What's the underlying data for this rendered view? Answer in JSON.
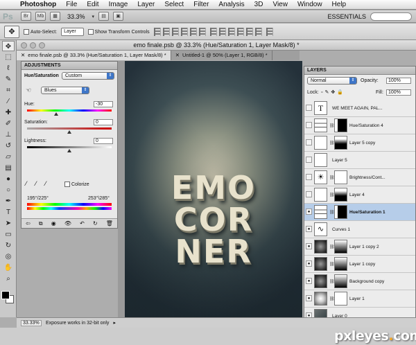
{
  "menubar": {
    "apple_icon": "apple-icon",
    "items": [
      "Photoshop",
      "File",
      "Edit",
      "Image",
      "Layer",
      "Select",
      "Filter",
      "Analysis",
      "3D",
      "View",
      "Window",
      "Help"
    ]
  },
  "appbar": {
    "logo": "Ps",
    "zoom": "33.3%",
    "workspace": "ESSENTIALS"
  },
  "options": {
    "auto_select_label": "Auto-Select:",
    "auto_select_value": "Layer",
    "transform_label": "Show Transform Controls"
  },
  "window": {
    "title": "emo finale.psb @ 33.3% (Hue/Saturation 1, Layer Mask/8) *"
  },
  "tabs": [
    {
      "label": "emo finale.psb @ 33.3% (Hue/Saturation 1, Layer Mask/8) *",
      "active": true
    },
    {
      "label": "Untitled-1 @ 50% (Layer 1, RGB/8) *",
      "active": false
    }
  ],
  "adjustments": {
    "panel_title": "ADJUSTMENTS",
    "type_label": "Hue/Saturation",
    "preset": "Custom",
    "channel": "Blues",
    "hue_label": "Hue:",
    "hue_value": "-30",
    "saturation_label": "Saturation:",
    "saturation_value": "0",
    "lightness_label": "Lightness:",
    "lightness_value": "0",
    "colorize_label": "Colorize",
    "range_left": "195°/225°",
    "range_right": "253°\\285°"
  },
  "canvas": {
    "lines": [
      "EMO",
      "COR",
      "NER"
    ]
  },
  "layers": {
    "panel_title": "LAYERS",
    "blend_mode": "Normal",
    "opacity_label": "Opacity:",
    "opacity_value": "100%",
    "lock_label": "Lock:",
    "fill_label": "Fill:",
    "fill_value": "100%",
    "items": [
      {
        "name": "WE MEET AGAIN, PAL...",
        "visible": false,
        "kind": "text"
      },
      {
        "name": "Hue/Saturation 4",
        "visible": false,
        "kind": "hue"
      },
      {
        "name": "Layer 5 copy",
        "visible": false,
        "kind": "mask"
      },
      {
        "name": "Layer 5",
        "visible": false,
        "kind": "blank"
      },
      {
        "name": "Brightness/Cont...",
        "visible": false,
        "kind": "bright"
      },
      {
        "name": "Layer 4",
        "visible": false,
        "kind": "mask"
      },
      {
        "name": "Hue/Saturation 1",
        "visible": true,
        "kind": "hue",
        "active": true
      },
      {
        "name": "Curves 1",
        "visible": true,
        "kind": "curves"
      },
      {
        "name": "Layer 1 copy 2",
        "visible": true,
        "kind": "dark"
      },
      {
        "name": "Layer 1 copy",
        "visible": true,
        "kind": "dark"
      },
      {
        "name": "Background copy",
        "visible": true,
        "kind": "dark"
      },
      {
        "name": "Layer 1",
        "visible": true,
        "kind": "mid"
      },
      {
        "name": "Layer 0",
        "visible": true,
        "kind": "photo"
      }
    ]
  },
  "status": {
    "zoom": "33.33%",
    "message": "Exposure works in 32-bit only"
  },
  "watermark": {
    "text": "pxleyes.com"
  }
}
